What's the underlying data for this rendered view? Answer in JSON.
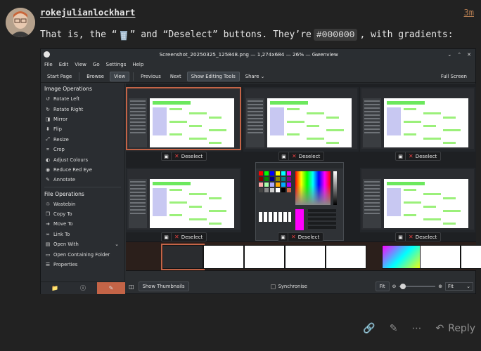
{
  "post": {
    "username": "rokejulianlockhart",
    "time": "3m",
    "text_pre": "That is, the “",
    "text_mid": "” and “Deselect” buttons. They’re ",
    "code": "#000000",
    "text_post": ", with gradients:"
  },
  "window": {
    "title": "Screenshot_20250325_125848.png — 1,274x684 — 26% — Gwenview",
    "menu": [
      "File",
      "Edit",
      "View",
      "Go",
      "Settings",
      "Help"
    ],
    "toolbar": {
      "start_page": "Start Page",
      "browse": "Browse",
      "view": "View",
      "previous": "Previous",
      "next": "Next",
      "show_editing_tools": "Show Editing Tools",
      "share": "Share",
      "full_screen": "Full Screen"
    },
    "sidebar": {
      "image_ops_heading": "Image Operations",
      "image_ops": [
        {
          "label": "Rotate Left",
          "icon": "rotate-left-icon"
        },
        {
          "label": "Rotate Right",
          "icon": "rotate-right-icon"
        },
        {
          "label": "Mirror",
          "icon": "mirror-icon"
        },
        {
          "label": "Flip",
          "icon": "flip-icon"
        },
        {
          "label": "Resize",
          "icon": "resize-icon"
        },
        {
          "label": "Crop",
          "icon": "crop-icon"
        },
        {
          "label": "Adjust Colours",
          "icon": "adjust-colours-icon"
        },
        {
          "label": "Reduce Red Eye",
          "icon": "red-eye-icon"
        },
        {
          "label": "Annotate",
          "icon": "annotate-icon"
        }
      ],
      "file_ops_heading": "File Operations",
      "file_ops": [
        {
          "label": "Wastebin",
          "icon": "wastebin-icon"
        },
        {
          "label": "Copy To",
          "icon": "copy-icon"
        },
        {
          "label": "Move To",
          "icon": "move-icon"
        },
        {
          "label": "Link To",
          "icon": "link-icon"
        },
        {
          "label": "Open With",
          "icon": "open-with-icon"
        },
        {
          "label": "Open Containing Folder",
          "icon": "folder-icon"
        },
        {
          "label": "Properties",
          "icon": "properties-icon"
        }
      ]
    },
    "thumb_title": "Character Set Comparison",
    "deselect_label": "Deselect",
    "status": {
      "show_thumbnails": "Show Thumbnails",
      "synchronise": "Synchronise",
      "fit": "Fit",
      "zoom_mode": "Fit"
    }
  },
  "actions": {
    "reply": "Reply"
  },
  "colors": {
    "background": "#222222",
    "accent": "#c46447",
    "deselect_x": "#e84141",
    "highlight": "#6ce85d"
  }
}
